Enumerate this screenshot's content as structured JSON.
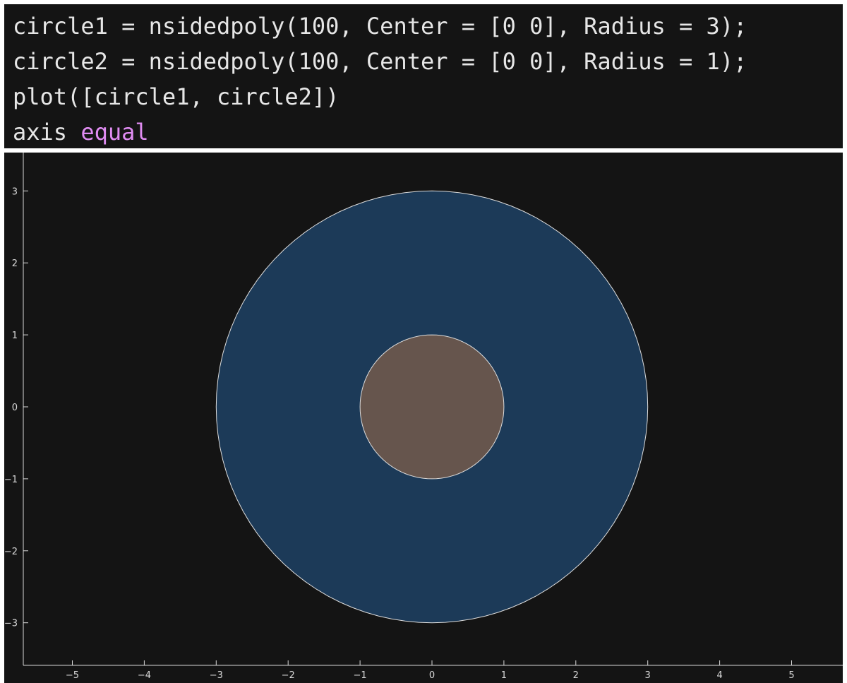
{
  "code": {
    "lines": [
      {
        "text": "circle1 = nsidedpoly(100, Center = [0 0], Radius = 3);",
        "keyword": ""
      },
      {
        "text": "circle2 = nsidedpoly(100, Center = [0 0], Radius = 1);",
        "keyword": ""
      },
      {
        "text": "plot([circle1, circle2])",
        "keyword": ""
      },
      {
        "text": "axis ",
        "keyword": "equal"
      }
    ],
    "keyword_color": "#e08cf2",
    "text_color": "#e6e6e6",
    "background": "#141414"
  },
  "chart_data": {
    "type": "area",
    "title": "",
    "xlabel": "",
    "ylabel": "",
    "xlim": [
      -5.7,
      5.7
    ],
    "ylim": [
      -3.6,
      3.6
    ],
    "xticks": [
      -5,
      -4,
      -3,
      -2,
      -1,
      0,
      1,
      2,
      3,
      4,
      5
    ],
    "yticks": [
      -3,
      -2,
      -1,
      0,
      1,
      2,
      3
    ],
    "xtick_labels": [
      "−5",
      "−4",
      "−3",
      "−2",
      "−1",
      "0",
      "1",
      "2",
      "3",
      "4",
      "5"
    ],
    "ytick_labels": [
      "−3",
      "−2",
      "−1",
      "0",
      "1",
      "2",
      "3"
    ],
    "grid": false,
    "background": "#141414",
    "axis_color": "#d9d9d9",
    "series": [
      {
        "center": [
          0,
          0
        ],
        "radius": 3,
        "sides": 100,
        "fill": "#1c3a58",
        "edge": "#dcdcdc"
      },
      {
        "center": [
          0,
          0
        ],
        "radius": 1,
        "sides": 100,
        "fill": "#66554d",
        "edge": "#dcdcdc"
      }
    ]
  }
}
